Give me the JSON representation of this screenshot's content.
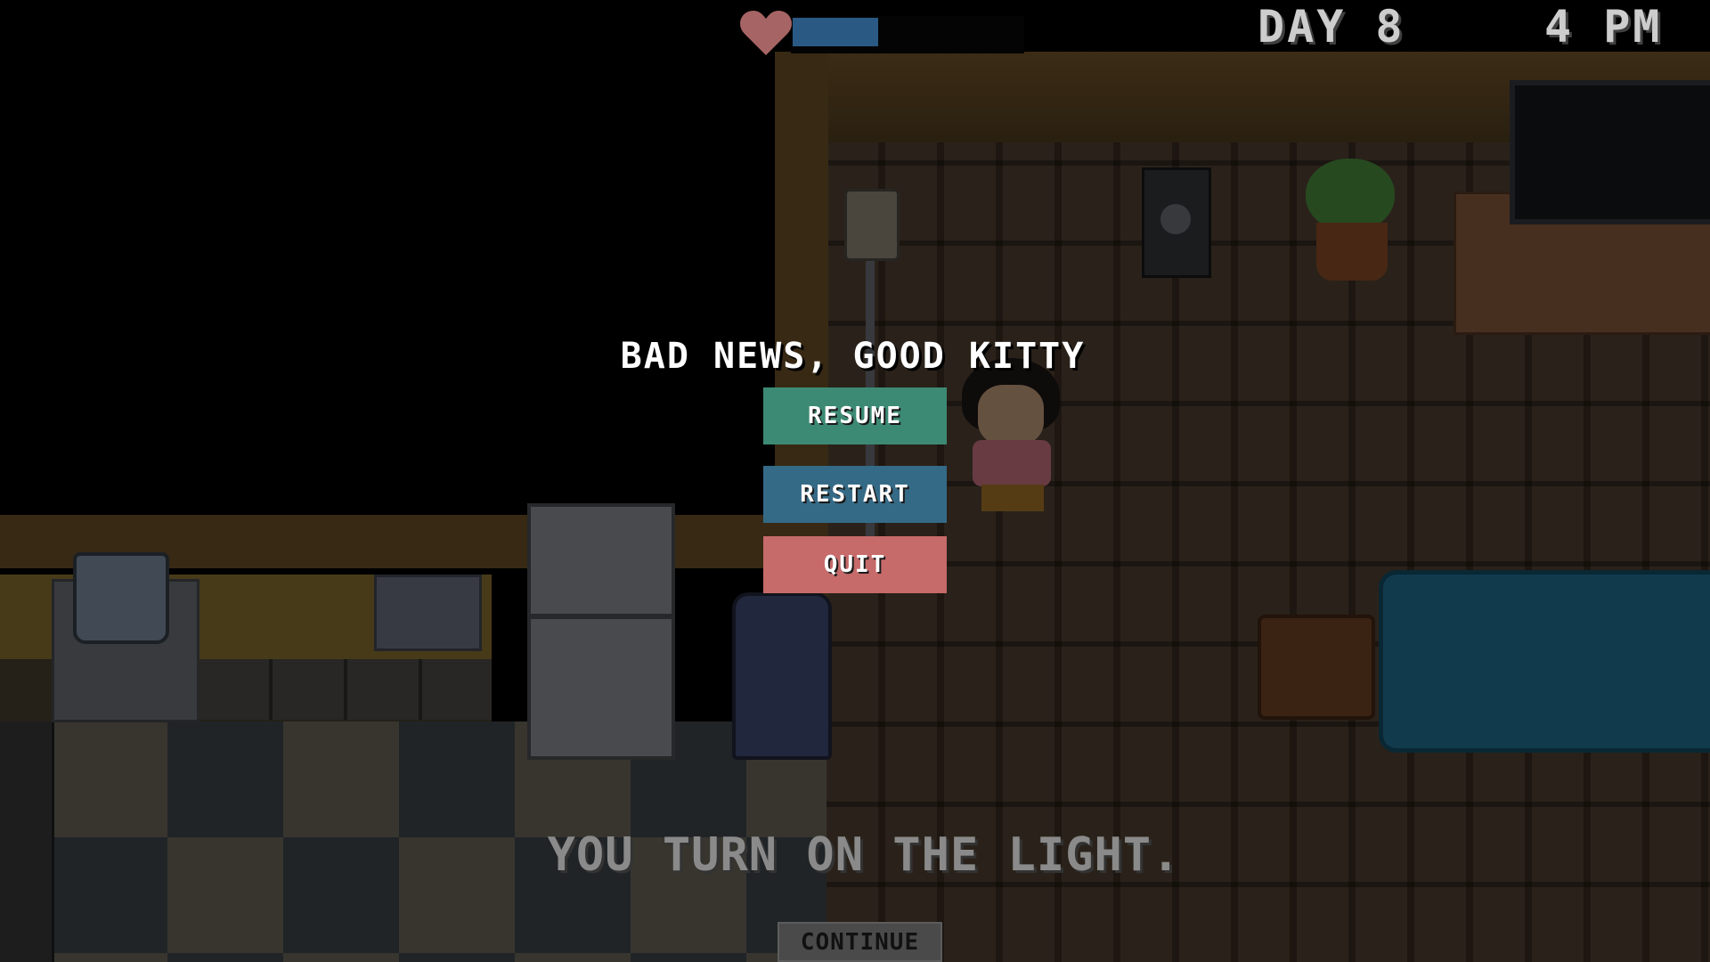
{
  "hud": {
    "day": "DAY 8",
    "time": "4 PM",
    "health_fraction": 0.37,
    "health_color": "#2d5f8c",
    "heart_icon": "heart-icon",
    "heart_color": "#b06a6a"
  },
  "pause_menu": {
    "title": "BAD NEWS, GOOD KITTY",
    "resume_label": "RESUME",
    "restart_label": "RESTART",
    "quit_label": "QUIT",
    "resume_color": "#3d8a74",
    "restart_color": "#356a86",
    "quit_color": "#c66a6a"
  },
  "dialog": {
    "text": "YOU TURN ON THE LIGHT.",
    "continue_label": "CONTINUE"
  }
}
